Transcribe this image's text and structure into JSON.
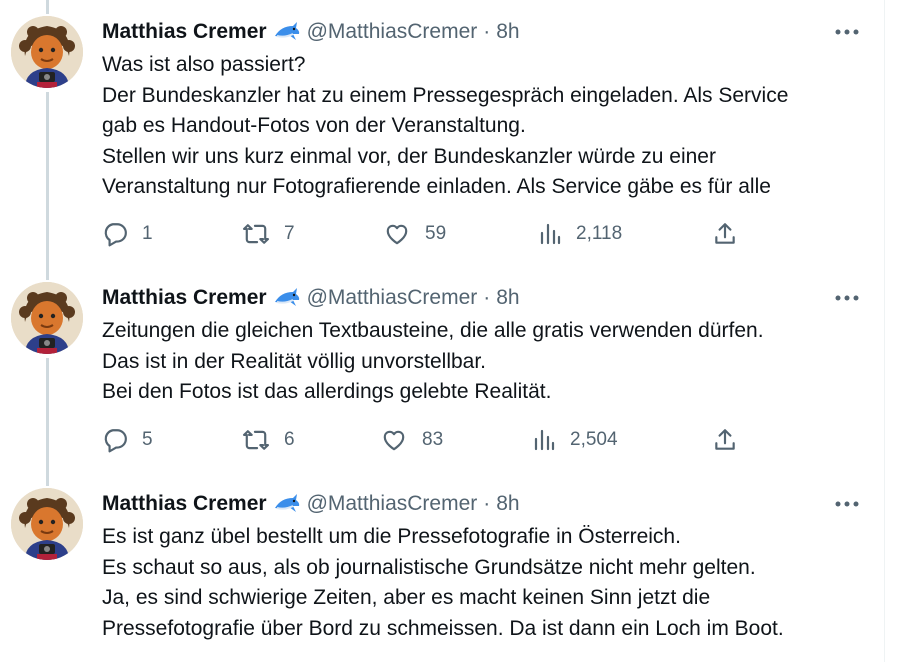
{
  "tweets": [
    {
      "author": "Matthias Cremer",
      "handle": "@MatthiasCremer",
      "separator": "·",
      "time": "8h",
      "lines": [
        "Was ist also passiert?",
        "Der Bundeskanzler hat zu einem Pressegespräch eingeladen. Als Service",
        "gab es Handout-Fotos von der Veranstaltung.",
        "Stellen wir uns kurz einmal vor, der Bundeskanzler würde zu einer",
        "Veranstaltung nur Fotografierende einladen. Als Service gäbe es für alle"
      ],
      "replies": "1",
      "retweets": "7",
      "likes": "59",
      "views": "2,118"
    },
    {
      "author": "Matthias Cremer",
      "handle": "@MatthiasCremer",
      "separator": "·",
      "time": "8h",
      "lines": [
        "Zeitungen die gleichen Textbausteine, die alle gratis verwenden dürfen.",
        "Das ist in der Realität völlig unvorstellbar.",
        "Bei den Fotos ist das allerdings gelebte Realität."
      ],
      "replies": "5",
      "retweets": "6",
      "likes": "83",
      "views": "2,504"
    },
    {
      "author": "Matthias Cremer",
      "handle": "@MatthiasCremer",
      "separator": "·",
      "time": "8h",
      "lines": [
        "Es ist ganz übel bestellt um die Pressefotografie in Österreich.",
        "Es schaut so aus, als ob journalistische Grundsätze nicht mehr gelten.",
        "Ja, es sind schwierige Zeiten, aber es macht keinen Sinn jetzt die",
        "Pressefotografie über Bord zu schmeissen. Da ist dann ein Loch im Boot."
      ]
    }
  ],
  "icons": {
    "badge": "shark-emoji-icon",
    "more": "more-options-icon",
    "reply": "reply-icon",
    "retweet": "retweet-icon",
    "like": "heart-icon",
    "views": "views-chart-icon",
    "share": "share-icon"
  },
  "colors": {
    "text": "#0f1419",
    "secondary": "#536471",
    "thread_line": "#cfd9de",
    "badge_blue": "#3b8eea"
  }
}
